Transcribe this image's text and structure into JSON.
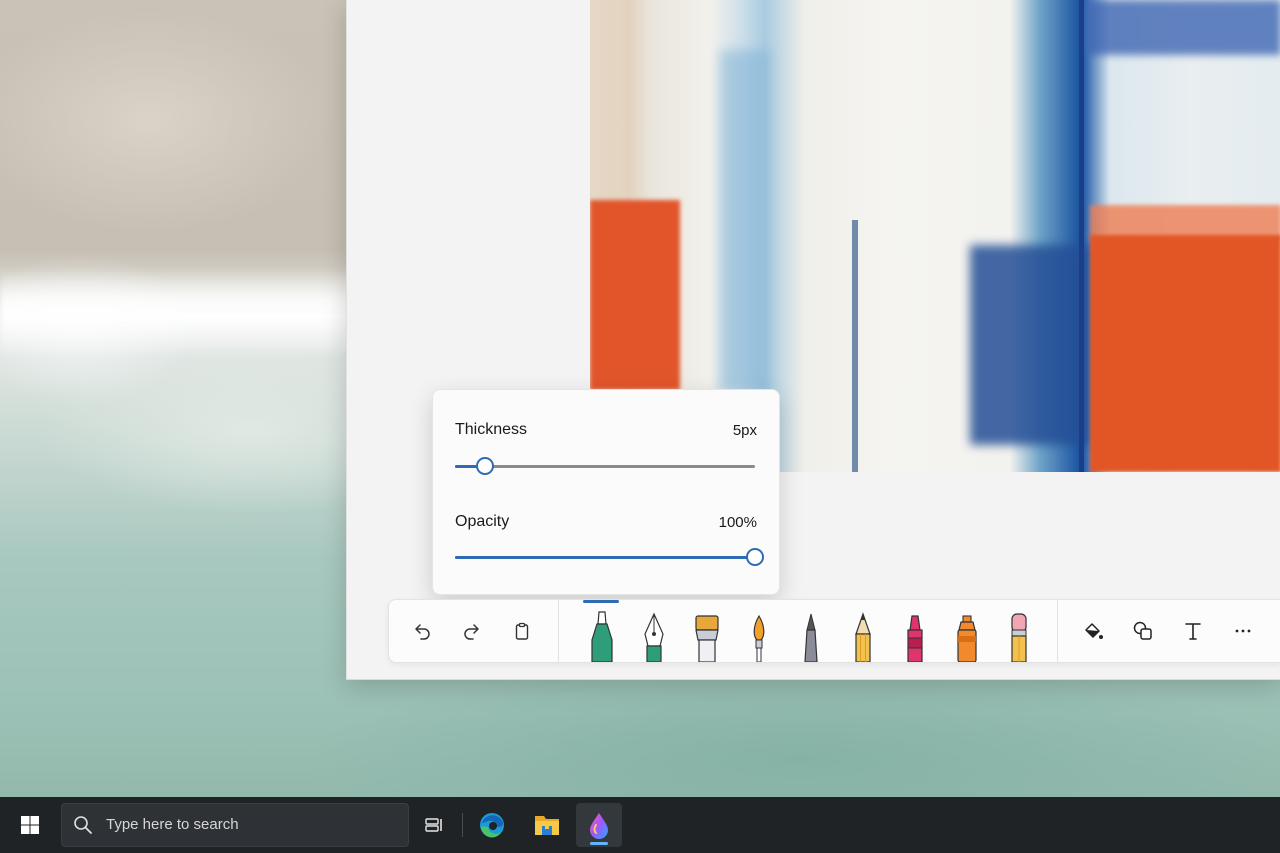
{
  "popup": {
    "thickness_label": "Thickness",
    "thickness_value": "5px",
    "thickness_fraction": 0.1,
    "opacity_label": "Opacity",
    "opacity_value": "100%",
    "opacity_fraction": 1.0
  },
  "toolbar": {
    "left_buttons": [
      {
        "name": "undo-button",
        "icon": "undo-icon"
      },
      {
        "name": "redo-button",
        "icon": "redo-icon"
      },
      {
        "name": "clipboard-button",
        "icon": "clipboard-icon"
      }
    ],
    "tools": [
      {
        "name": "tool-marker",
        "icon": "marker-icon",
        "selected": true,
        "color": "#2e9e7a"
      },
      {
        "name": "tool-fountain-pen",
        "icon": "fountain-pen-icon",
        "color": "#2e9e7a"
      },
      {
        "name": "tool-paint-brush",
        "icon": "paint-brush-icon",
        "color": "#e8a73a"
      },
      {
        "name": "tool-watercolor-brush",
        "icon": "watercolor-brush-icon",
        "color": "#f0a12b"
      },
      {
        "name": "tool-fine-pen",
        "icon": "fine-pen-icon",
        "color": "#8a8d99"
      },
      {
        "name": "tool-pencil",
        "icon": "pencil-icon",
        "color": "#f2c14e"
      },
      {
        "name": "tool-crayon",
        "icon": "crayon-icon",
        "color": "#e0356c"
      },
      {
        "name": "tool-spray-can",
        "icon": "spray-can-icon",
        "color": "#f08a2c"
      },
      {
        "name": "tool-eraser",
        "icon": "eraser-icon",
        "color": "#f2a6b4"
      }
    ],
    "right_buttons": [
      {
        "name": "fill-button",
        "icon": "paint-bucket-icon"
      },
      {
        "name": "shapes-button",
        "icon": "shapes-icon"
      },
      {
        "name": "text-button",
        "icon": "text-icon"
      },
      {
        "name": "more-button",
        "icon": "more-icon"
      }
    ]
  },
  "taskbar": {
    "search_placeholder": "Type here to search",
    "apps": [
      {
        "name": "task-view-button",
        "icon": "task-view-icon"
      },
      {
        "name": "edge-button",
        "icon": "edge-icon"
      },
      {
        "name": "file-explorer-button",
        "icon": "folder-icon"
      },
      {
        "name": "fresh-paint-button",
        "icon": "paint-drop-icon",
        "active": true
      }
    ]
  },
  "colors": {
    "accent": "#2f6bb5",
    "taskbar": "#1f2326",
    "toolbar_bg": "#fcfcfc"
  }
}
